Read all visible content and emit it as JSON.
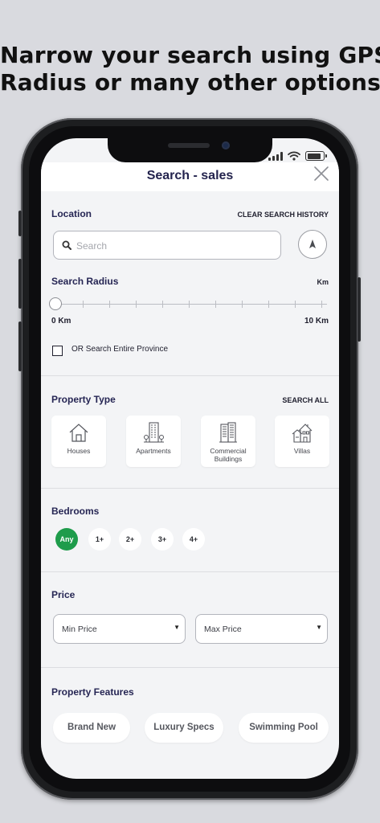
{
  "promo": {
    "line1": "Narrow your search using GPS,",
    "line2": "Radius or many other options"
  },
  "header": {
    "title": "Search - sales"
  },
  "location": {
    "label": "Location",
    "clear_label": "CLEAR SEARCH HISTORY",
    "search_placeholder": "Search",
    "search_value": ""
  },
  "radius": {
    "label": "Search Radius",
    "unit": "Km",
    "min_label": "0 Km",
    "max_label": "10 Km",
    "value_fraction": 0
  },
  "province": {
    "label": "OR Search Entire Province",
    "checked": false
  },
  "property_type": {
    "label": "Property Type",
    "search_all_label": "SEARCH ALL",
    "items": [
      {
        "label": "Houses",
        "icon": "house-icon"
      },
      {
        "label": "Apartments",
        "icon": "apartment-icon"
      },
      {
        "label": "Commercial Buildings",
        "icon": "commercial-building-icon"
      },
      {
        "label": "Villas",
        "icon": "villa-icon"
      }
    ]
  },
  "bedrooms": {
    "label": "Bedrooms",
    "options": [
      "Any",
      "1+",
      "2+",
      "3+",
      "4+"
    ],
    "selected": "Any"
  },
  "price": {
    "label": "Price",
    "min_label": "Min Price",
    "max_label": "Max Price"
  },
  "features": {
    "label": "Property Features",
    "items": [
      "Brand New",
      "Luxury Specs",
      "Swimming Pool"
    ]
  },
  "colors": {
    "accent_green": "#1e9c4b",
    "title_navy": "#23234d"
  }
}
